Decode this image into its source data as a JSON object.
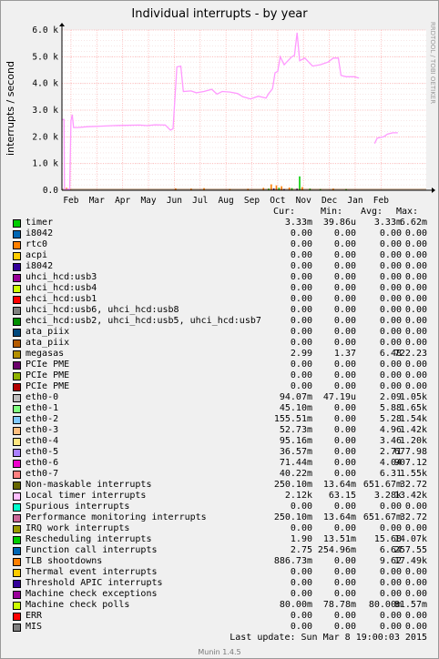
{
  "chart_data": {
    "type": "line",
    "title": "Individual interrupts - by year",
    "ylabel": "interrupts / second",
    "watermark": "RRDTOOL / TOBI OETIKER",
    "ylim": [
      0,
      6000
    ],
    "yticks": [
      {
        "v": 0,
        "label": "0.0"
      },
      {
        "v": 1000,
        "label": "1.0 k"
      },
      {
        "v": 2000,
        "label": "2.0 k"
      },
      {
        "v": 3000,
        "label": "3.0 k"
      },
      {
        "v": 4000,
        "label": "4.0 k"
      },
      {
        "v": 5000,
        "label": "5.0 k"
      },
      {
        "v": 6000,
        "label": "6.0 k"
      }
    ],
    "xlim": [
      0,
      14.1
    ],
    "xticks": [
      {
        "v": 0.35,
        "label": "Feb"
      },
      {
        "v": 1.35,
        "label": "Mar"
      },
      {
        "v": 2.35,
        "label": "Apr"
      },
      {
        "v": 3.35,
        "label": "May"
      },
      {
        "v": 4.35,
        "label": "Jun"
      },
      {
        "v": 5.35,
        "label": "Jul"
      },
      {
        "v": 6.35,
        "label": "Aug"
      },
      {
        "v": 7.35,
        "label": "Sep"
      },
      {
        "v": 8.35,
        "label": "Oct"
      },
      {
        "v": 9.35,
        "label": "Nov"
      },
      {
        "v": 10.35,
        "label": "Dec"
      },
      {
        "v": 11.35,
        "label": "Jan"
      },
      {
        "v": 12.35,
        "label": "Feb"
      }
    ],
    "grid": true,
    "series": [
      {
        "name": "eth0-6",
        "color": "#FF99FF",
        "segments": [
          [
            [
              0.0,
              2650
            ],
            [
              0.08,
              2650
            ],
            [
              0.1,
              30
            ],
            [
              0.22,
              30
            ],
            [
              0.25,
              50
            ],
            [
              0.3,
              30
            ],
            [
              0.35,
              2600
            ],
            [
              0.4,
              2830
            ],
            [
              0.45,
              2350
            ],
            [
              0.6,
              2350
            ],
            [
              1.0,
              2380
            ],
            [
              1.5,
              2400
            ],
            [
              2.0,
              2420
            ],
            [
              2.5,
              2430
            ],
            [
              3.0,
              2440
            ],
            [
              3.3,
              2420
            ],
            [
              3.6,
              2450
            ],
            [
              4.0,
              2440
            ],
            [
              4.2,
              2250
            ],
            [
              4.3,
              2300
            ],
            [
              4.45,
              4620
            ],
            [
              4.6,
              4650
            ],
            [
              4.7,
              3700
            ],
            [
              5.0,
              3720
            ],
            [
              5.2,
              3650
            ],
            [
              5.5,
              3700
            ],
            [
              5.8,
              3780
            ],
            [
              6.0,
              3600
            ],
            [
              6.2,
              3700
            ],
            [
              6.5,
              3680
            ],
            [
              6.8,
              3620
            ],
            [
              7.0,
              3500
            ],
            [
              7.3,
              3420
            ],
            [
              7.6,
              3520
            ],
            [
              7.9,
              3450
            ],
            [
              8.0,
              3620
            ],
            [
              8.15,
              3800
            ],
            [
              8.25,
              4400
            ],
            [
              8.35,
              4450
            ],
            [
              8.45,
              5000
            ],
            [
              8.6,
              4700
            ],
            [
              8.75,
              4850
            ],
            [
              8.9,
              5000
            ],
            [
              9.0,
              5050
            ],
            [
              9.1,
              5900
            ],
            [
              9.2,
              4850
            ],
            [
              9.4,
              4950
            ],
            [
              9.7,
              4650
            ],
            [
              10.0,
              4700
            ],
            [
              10.3,
              4800
            ],
            [
              10.5,
              4950
            ],
            [
              10.7,
              4950
            ],
            [
              10.8,
              4300
            ],
            [
              11.0,
              4250
            ],
            [
              11.3,
              4250
            ],
            [
              11.5,
              4200
            ]
          ],
          [
            [
              12.1,
              1750
            ],
            [
              12.2,
              1950
            ],
            [
              12.45,
              2000
            ],
            [
              12.6,
              2100
            ],
            [
              12.8,
              2150
            ],
            [
              13.0,
              2150
            ]
          ]
        ]
      }
    ],
    "spikes": [
      {
        "color": "#FF7D00",
        "bars": [
          [
            0.18,
            90
          ],
          [
            0.3,
            60
          ],
          [
            4.4,
            70
          ],
          [
            5.0,
            60
          ],
          [
            5.5,
            80
          ],
          [
            6.5,
            40
          ],
          [
            7.2,
            50
          ],
          [
            7.8,
            90
          ],
          [
            8.1,
            220
          ],
          [
            8.3,
            180
          ],
          [
            8.5,
            150
          ],
          [
            8.8,
            100
          ],
          [
            9.3,
            120
          ],
          [
            10.5,
            60
          ]
        ]
      },
      {
        "color": "#00CC00",
        "bars": [
          [
            8.0,
            60
          ],
          [
            8.4,
            90
          ],
          [
            8.9,
            80
          ],
          [
            9.2,
            520
          ],
          [
            9.6,
            60
          ],
          [
            10.0,
            40
          ],
          [
            11.0,
            40
          ]
        ]
      },
      {
        "color": "#330099",
        "bars": [
          [
            8.2,
            70
          ],
          [
            8.6,
            40
          ],
          [
            9.1,
            60
          ]
        ]
      }
    ]
  },
  "legend": {
    "headers": {
      "cur": "Cur:",
      "min": "Min:",
      "avg": "Avg:",
      "max": "Max:"
    },
    "rows": [
      {
        "label": "timer",
        "color": "#00CC00",
        "cur": "3.33m",
        "min": "39.86u",
        "avg": "3.33m",
        "max": "6.62m"
      },
      {
        "label": "i8042",
        "color": "#0066B3",
        "cur": "0.00",
        "min": "0.00",
        "avg": "0.00",
        "max": "0.00"
      },
      {
        "label": "rtc0",
        "color": "#FF8000",
        "cur": "0.00",
        "min": "0.00",
        "avg": "0.00",
        "max": "0.00"
      },
      {
        "label": "acpi",
        "color": "#FFCC00",
        "cur": "0.00",
        "min": "0.00",
        "avg": "0.00",
        "max": "0.00"
      },
      {
        "label": "i8042",
        "color": "#330099",
        "cur": "0.00",
        "min": "0.00",
        "avg": "0.00",
        "max": "0.00"
      },
      {
        "label": "uhci_hcd:usb3",
        "color": "#990099",
        "cur": "0.00",
        "min": "0.00",
        "avg": "0.00",
        "max": "0.00"
      },
      {
        "label": "uhci_hcd:usb4",
        "color": "#CCFF00",
        "cur": "0.00",
        "min": "0.00",
        "avg": "0.00",
        "max": "0.00"
      },
      {
        "label": "ehci_hcd:usb1",
        "color": "#FF0000",
        "cur": "0.00",
        "min": "0.00",
        "avg": "0.00",
        "max": "0.00"
      },
      {
        "label": "uhci_hcd:usb6, uhci_hcd:usb8",
        "color": "#808080",
        "cur": "0.00",
        "min": "0.00",
        "avg": "0.00",
        "max": "0.00"
      },
      {
        "label": "ehci_hcd:usb2, uhci_hcd:usb5, uhci_hcd:usb7",
        "color": "#008F00",
        "cur": "0.00",
        "min": "0.00",
        "avg": "0.00",
        "max": "0.00"
      },
      {
        "label": "ata_piix",
        "color": "#00487D",
        "cur": "0.00",
        "min": "0.00",
        "avg": "0.00",
        "max": "0.00"
      },
      {
        "label": "ata_piix",
        "color": "#B35A00",
        "cur": "0.00",
        "min": "0.00",
        "avg": "0.00",
        "max": "0.00"
      },
      {
        "label": "megasas",
        "color": "#B38F00",
        "cur": "2.99",
        "min": "1.37",
        "avg": "6.48",
        "max": "722.23"
      },
      {
        "label": "PCIe PME",
        "color": "#6B006B",
        "cur": "0.00",
        "min": "0.00",
        "avg": "0.00",
        "max": "0.00"
      },
      {
        "label": "PCIe PME",
        "color": "#8FB300",
        "cur": "0.00",
        "min": "0.00",
        "avg": "0.00",
        "max": "0.00"
      },
      {
        "label": "PCIe PME",
        "color": "#B30000",
        "cur": "0.00",
        "min": "0.00",
        "avg": "0.00",
        "max": "0.00"
      },
      {
        "label": "eth0-0",
        "color": "#BEBEBE",
        "cur": "94.07m",
        "min": "47.19u",
        "avg": "2.09",
        "max": "1.05k"
      },
      {
        "label": "eth0-1",
        "color": "#80FF80",
        "cur": "45.10m",
        "min": "0.00",
        "avg": "5.88",
        "max": "1.65k"
      },
      {
        "label": "eth0-2",
        "color": "#80C9FF",
        "cur": "155.51m",
        "min": "0.00",
        "avg": "5.28",
        "max": "1.54k"
      },
      {
        "label": "eth0-3",
        "color": "#FFC080",
        "cur": "52.73m",
        "min": "0.00",
        "avg": "4.96",
        "max": "1.42k"
      },
      {
        "label": "eth0-4",
        "color": "#FFE680",
        "cur": "95.16m",
        "min": "0.00",
        "avg": "3.46",
        "max": "1.20k"
      },
      {
        "label": "eth0-5",
        "color": "#AA80FF",
        "cur": "36.57m",
        "min": "0.00",
        "avg": "2.71",
        "max": "677.98"
      },
      {
        "label": "eth0-6",
        "color": "#EE00CC",
        "cur": "71.44m",
        "min": "0.00",
        "avg": "4.04",
        "max": "907.12"
      },
      {
        "label": "eth0-7",
        "color": "#FF8080",
        "cur": "40.22m",
        "min": "0.00",
        "avg": "6.31",
        "max": "1.55k"
      },
      {
        "label": "Non-maskable interrupts",
        "color": "#666600",
        "cur": "250.10m",
        "min": "13.64m",
        "avg": "651.67m",
        "max": "32.72"
      },
      {
        "label": "Local timer interrupts",
        "color": "#FFBFFF",
        "cur": "2.12k",
        "min": "63.15",
        "avg": "3.28k",
        "max": "13.42k"
      },
      {
        "label": "Spurious interrupts",
        "color": "#00FFCC",
        "cur": "0.00",
        "min": "0.00",
        "avg": "0.00",
        "max": "0.00"
      },
      {
        "label": "Performance monitoring interrupts",
        "color": "#CC6699",
        "cur": "250.10m",
        "min": "13.64m",
        "avg": "651.67m",
        "max": "32.72"
      },
      {
        "label": "IRQ work interrupts",
        "color": "#999900",
        "cur": "0.00",
        "min": "0.00",
        "avg": "0.00",
        "max": "0.00"
      },
      {
        "label": "Rescheduling interrupts",
        "color": "#00CC00",
        "cur": "1.90",
        "min": "13.51m",
        "avg": "15.68",
        "max": "14.07k"
      },
      {
        "label": "Function call interrupts",
        "color": "#0066B3",
        "cur": "2.75",
        "min": "254.96m",
        "avg": "6.64",
        "max": "257.55"
      },
      {
        "label": "TLB shootdowns",
        "color": "#FF8000",
        "cur": "886.73m",
        "min": "0.00",
        "avg": "9.62",
        "max": "17.49k"
      },
      {
        "label": "Thermal event interrupts",
        "color": "#FFCC00",
        "cur": "0.00",
        "min": "0.00",
        "avg": "0.00",
        "max": "0.00"
      },
      {
        "label": "Threshold APIC interrupts",
        "color": "#330099",
        "cur": "0.00",
        "min": "0.00",
        "avg": "0.00",
        "max": "0.00"
      },
      {
        "label": "Machine check exceptions",
        "color": "#990099",
        "cur": "0.00",
        "min": "0.00",
        "avg": "0.00",
        "max": "0.00"
      },
      {
        "label": "Machine check polls",
        "color": "#CCFF00",
        "cur": "80.00m",
        "min": "78.78m",
        "avg": "80.00m",
        "max": "81.57m"
      },
      {
        "label": "ERR",
        "color": "#FF0000",
        "cur": "0.00",
        "min": "0.00",
        "avg": "0.00",
        "max": "0.00"
      },
      {
        "label": "MIS",
        "color": "#808080",
        "cur": "0.00",
        "min": "0.00",
        "avg": "0.00",
        "max": "0.00"
      }
    ]
  },
  "footer": {
    "last_update": "Last update:  Sun Mar  8 19:00:03 2015",
    "version": "Munin 1.4.5"
  },
  "colors": {
    "background": "#F0F0F0",
    "plot_bg": "#FFFFFF",
    "grid": "#FFB0B0",
    "axis": "#000000"
  }
}
